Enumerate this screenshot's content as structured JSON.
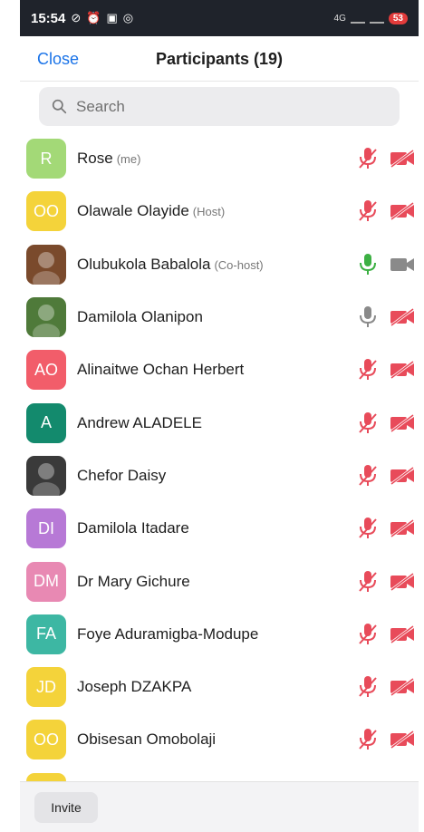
{
  "status_bar": {
    "time": "15:54",
    "icons": [
      "no-disturb-icon",
      "alarm-icon",
      "nfc-icon",
      "instagram-icon"
    ],
    "network": "4G",
    "battery": "53"
  },
  "header": {
    "close_label": "Close",
    "title": "Participants (19)"
  },
  "search": {
    "placeholder": "Search"
  },
  "colors": {
    "accent": "#1a73e8",
    "muted_red": "#e84b5a",
    "active_green": "#3cb043",
    "inactive_gray": "#8a8a8a"
  },
  "participants": [
    {
      "initials": "R",
      "avatar_color": "#a3d977",
      "avatar_type": "initials",
      "name": "Rose",
      "role": "(me)",
      "mic": "muted",
      "video": "off"
    },
    {
      "initials": "OO",
      "avatar_color": "#f4d33a",
      "avatar_type": "initials",
      "name": "Olawale Olayide",
      "role": "(Host)",
      "mic": "muted",
      "video": "off"
    },
    {
      "initials": "",
      "avatar_color": "#7a4a2c",
      "avatar_type": "photo",
      "name": "Olubukola Babalola",
      "role": "(Co-host)",
      "mic": "active",
      "video": "on"
    },
    {
      "initials": "",
      "avatar_color": "#4f7a3a",
      "avatar_type": "photo",
      "name": "Damilola Olanipon",
      "role": "",
      "mic": "unmuted",
      "video": "off"
    },
    {
      "initials": "AO",
      "avatar_color": "#f25d6a",
      "avatar_type": "initials",
      "name": "Alinaitwe Ochan Herbert",
      "role": "",
      "mic": "muted",
      "video": "off"
    },
    {
      "initials": "A",
      "avatar_color": "#138a6d",
      "avatar_type": "initials",
      "name": "Andrew ALADELE",
      "role": "",
      "mic": "muted",
      "video": "off"
    },
    {
      "initials": "",
      "avatar_color": "#3a3a3a",
      "avatar_type": "photo",
      "name": "Chefor Daisy",
      "role": "",
      "mic": "muted",
      "video": "off"
    },
    {
      "initials": "DI",
      "avatar_color": "#b779d6",
      "avatar_type": "initials",
      "name": "Damilola Itadare",
      "role": "",
      "mic": "muted",
      "video": "off"
    },
    {
      "initials": "DM",
      "avatar_color": "#e889b3",
      "avatar_type": "initials",
      "name": "Dr Mary Gichure",
      "role": "",
      "mic": "muted",
      "video": "off"
    },
    {
      "initials": "FA",
      "avatar_color": "#3db7a3",
      "avatar_type": "initials",
      "name": "Foye Aduramigba-Modupe",
      "role": "",
      "mic": "muted",
      "video": "off"
    },
    {
      "initials": "JD",
      "avatar_color": "#f4d33a",
      "avatar_type": "initials",
      "name": "Joseph DZAKPA",
      "role": "",
      "mic": "muted",
      "video": "off"
    },
    {
      "initials": "OO",
      "avatar_color": "#f4d33a",
      "avatar_type": "initials",
      "name": "Obisesan Omobolaji",
      "role": "",
      "mic": "muted",
      "video": "off"
    }
  ],
  "footer": {
    "invite_label": "Invite"
  }
}
